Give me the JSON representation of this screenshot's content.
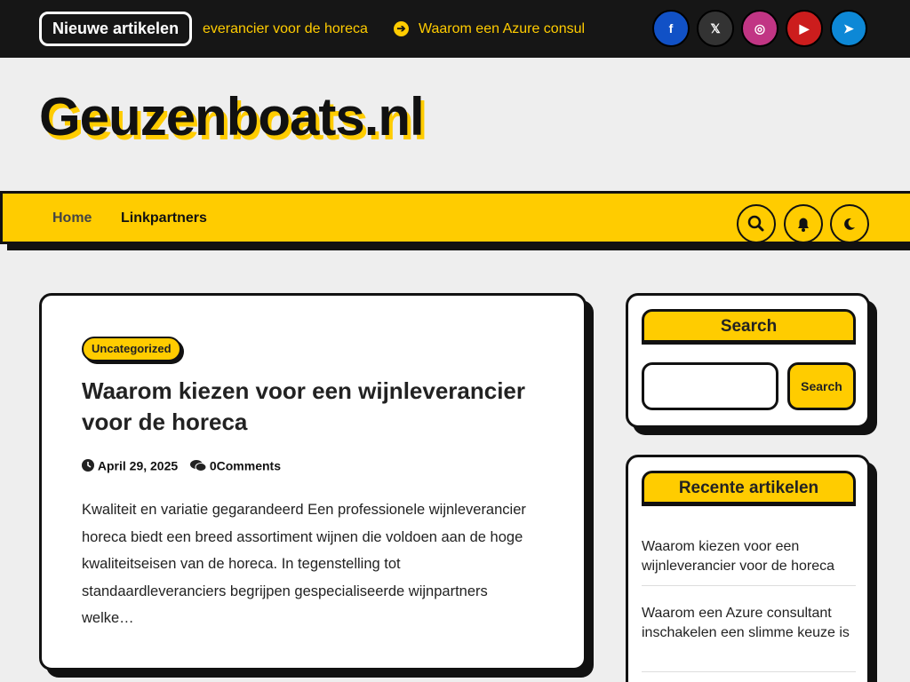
{
  "topbar": {
    "news_label": "Nieuwe artikelen",
    "ticker": [
      "everancier voor de horeca",
      "Waarom een Azure consul"
    ],
    "social": [
      {
        "name": "facebook",
        "glyph": "f",
        "color": "#1151c6"
      },
      {
        "name": "x",
        "glyph": "𝕏",
        "color": "#333333"
      },
      {
        "name": "instagram",
        "glyph": "◎",
        "color": "#c13584"
      },
      {
        "name": "youtube",
        "glyph": "▶",
        "color": "#cc1d1d"
      },
      {
        "name": "telegram",
        "glyph": "➤",
        "color": "#0d88d6"
      }
    ]
  },
  "header": {
    "site_title": "Geuzenboats.nl"
  },
  "nav": {
    "items": [
      "Home",
      "Linkpartners"
    ],
    "buttons": [
      "search-icon",
      "bell-icon",
      "moon-icon"
    ]
  },
  "post": {
    "category": "Uncategorized",
    "title": "Waarom kiezen voor een wijnleverancier voor de horeca",
    "date": "April 29, 2025",
    "comments": "0Comments",
    "excerpt": "Kwaliteit en variatie gegarandeerd Een professionele wijnleverancier horeca biedt een breed assortiment wijnen die voldoen aan de hoge kwaliteitseisen van de horeca. In tegenstelling tot standaardleveranciers begrijpen gespecialiseerde wijnpartners welke…"
  },
  "sidebar": {
    "search_title": "Search",
    "search_button": "Search",
    "recent_title": "Recente artikelen",
    "recent": [
      "Waarom kiezen voor een wijnleverancier voor de horeca",
      "Waarom een Azure consultant inschakelen een slimme keuze is"
    ]
  },
  "colors": {
    "accent": "#ffcc00",
    "dark": "#161616"
  }
}
